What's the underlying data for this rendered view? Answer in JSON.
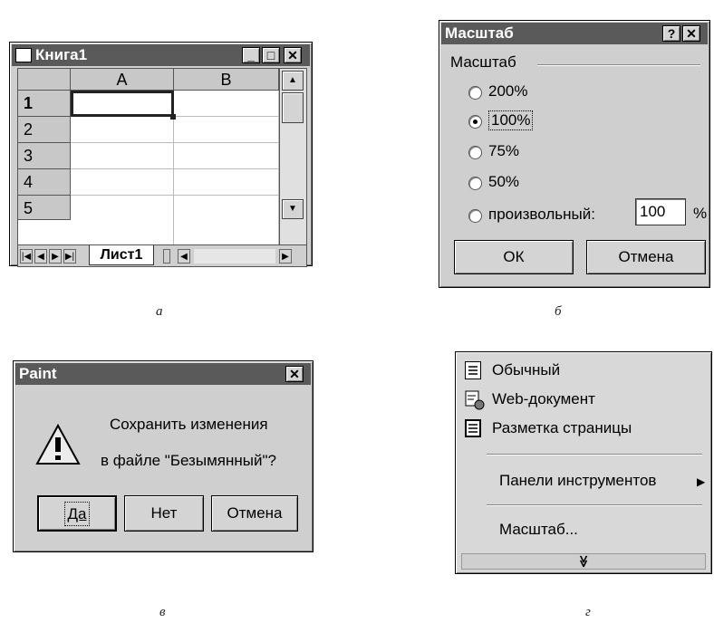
{
  "excel": {
    "title": "Книга1",
    "columns": [
      "A",
      "B"
    ],
    "rows": [
      "1",
      "2",
      "3",
      "4",
      "5"
    ],
    "sheet_tab": "Лист1",
    "caption": "а"
  },
  "zoom_dialog": {
    "title": "Масштаб",
    "group_label": "Масштаб",
    "options": [
      "200%",
      "100%",
      "75%",
      "50%",
      "произвольный:"
    ],
    "selected": "100%",
    "custom_value": "100",
    "percent_sign": "%",
    "ok": "ОК",
    "cancel": "Отмена",
    "caption": "б"
  },
  "paint_dialog": {
    "title": "Paint",
    "message_line1": "Сохранить изменения",
    "message_line2": "в файле \"Безымянный\"?",
    "yes": "Да",
    "no": "Нет",
    "cancel": "Отмена",
    "caption": "в"
  },
  "view_menu": {
    "items": [
      "Обычный",
      "Web-документ",
      "Разметка страницы",
      "Панели инструментов",
      "Масштаб..."
    ],
    "expand_glyph": "≫",
    "caption": "г"
  }
}
